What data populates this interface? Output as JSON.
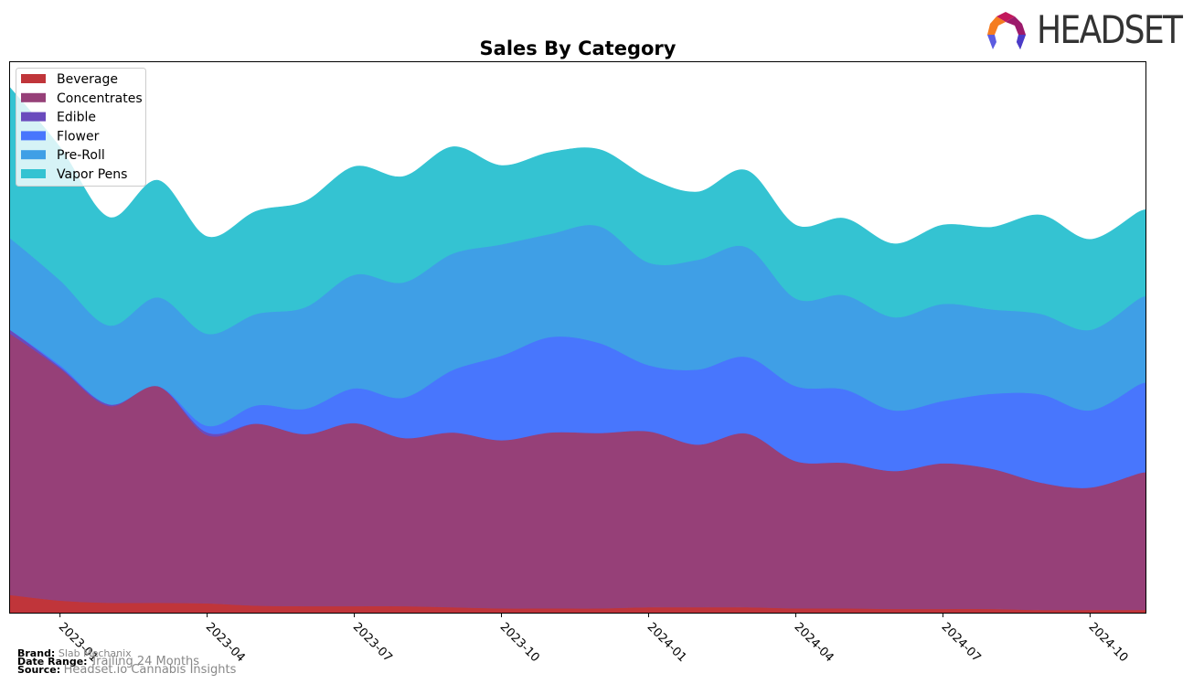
{
  "brand_logo": {
    "text": "HEADSET"
  },
  "footer": {
    "brand_label": "Brand:",
    "brand_value": "Slab Mechanix",
    "date_label": "Date Range:",
    "date_value": "Trailing 24 Months",
    "source_label": "Source:",
    "source_value": "Headset.io Cannabis Insights"
  },
  "chart_data": {
    "type": "area",
    "stacked": true,
    "smooth": true,
    "title": "Sales By Category",
    "xlabel": "",
    "ylabel": "",
    "y_ticks_visible": false,
    "units": "relative (no y-axis labels shown)",
    "x": [
      "2022-12",
      "2023-01",
      "2023-02",
      "2023-03",
      "2023-04",
      "2023-05",
      "2023-06",
      "2023-07",
      "2023-08",
      "2023-09",
      "2023-10",
      "2023-11",
      "2023-12",
      "2024-01",
      "2024-02",
      "2024-03",
      "2024-04",
      "2024-05",
      "2024-06",
      "2024-07",
      "2024-08",
      "2024-09",
      "2024-10",
      "2024-11"
    ],
    "x_tick_labels": [
      "2023-01",
      "2023-04",
      "2023-07",
      "2023-10",
      "2024-01",
      "2024-04",
      "2024-07",
      "2024-10"
    ],
    "ylim": [
      0,
      100
    ],
    "grid": false,
    "legend_position": "top-left",
    "series": [
      {
        "name": "Beverage",
        "color": "#c0353a",
        "values": [
          3.2,
          2.2,
          1.8,
          1.8,
          1.7,
          1.3,
          1.2,
          1.2,
          1.2,
          1.0,
          0.8,
          0.8,
          0.8,
          1.0,
          1.0,
          1.0,
          0.8,
          0.8,
          0.7,
          0.7,
          0.7,
          0.5,
          0.5,
          0.5
        ]
      },
      {
        "name": "Concentrates",
        "color": "#964078",
        "values": [
          47.3,
          42.1,
          35.7,
          39.3,
          30.5,
          33.0,
          31.2,
          33.2,
          30.5,
          31.7,
          30.5,
          31.9,
          31.8,
          31.9,
          29.5,
          31.5,
          26.7,
          26.4,
          25.0,
          26.4,
          25.4,
          23.1,
          22.2,
          24.8
        ]
      },
      {
        "name": "Edible",
        "color": "#6a4bbd",
        "values": [
          0.7,
          0.3,
          0.3,
          0,
          0.5,
          0,
          0,
          0,
          0,
          0,
          0,
          0,
          0,
          0,
          0,
          0,
          0,
          0,
          0,
          0,
          0,
          0,
          0,
          0
        ]
      },
      {
        "name": "Flower",
        "color": "#4876fd",
        "values": [
          0,
          0.3,
          0,
          0,
          1.2,
          3.3,
          4.6,
          6.3,
          7.3,
          11.3,
          15.3,
          17.3,
          16.3,
          12.0,
          13.6,
          13.9,
          13.6,
          13.3,
          11.0,
          11.3,
          13.6,
          16.0,
          14.0,
          16.1
        ]
      },
      {
        "name": "Pre-Roll",
        "color": "#3f9fe6",
        "values": [
          16.6,
          15.4,
          14.3,
          16.1,
          16.7,
          16.6,
          18.4,
          20.6,
          20.9,
          21.1,
          20.2,
          18.7,
          21.2,
          18.6,
          19.9,
          19.9,
          15.9,
          17.1,
          16.9,
          17.6,
          15.3,
          14.6,
          14.6,
          15.6
        ]
      },
      {
        "name": "Vapor Pens",
        "color": "#34c3d2",
        "values": [
          27.2,
          24.1,
          19.6,
          21.2,
          17.6,
          18.6,
          19.2,
          19.6,
          19.2,
          19.4,
          14.3,
          14.8,
          13.9,
          15.3,
          12.3,
          13.9,
          13.3,
          13.9,
          13.3,
          14.3,
          14.9,
          17.9,
          16.4,
          15.7
        ]
      }
    ]
  }
}
